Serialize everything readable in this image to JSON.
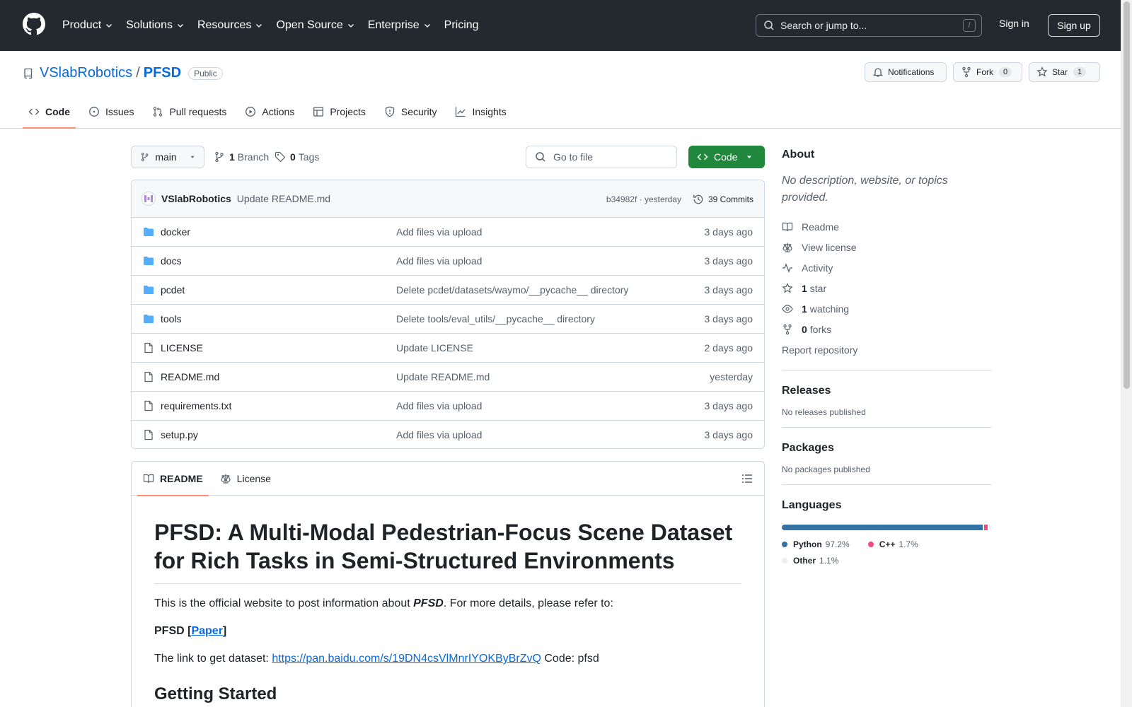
{
  "header": {
    "nav": [
      "Product",
      "Solutions",
      "Resources",
      "Open Source",
      "Enterprise",
      "Pricing"
    ],
    "search_placeholder": "Search or jump to...",
    "search_shortcut": "/",
    "sign_in": "Sign in",
    "sign_up": "Sign up"
  },
  "repo": {
    "owner": "VSlabRobotics",
    "separator": "/",
    "name": "PFSD",
    "visibility": "Public",
    "notifications_label": "Notifications",
    "fork_label": "Fork",
    "fork_count": "0",
    "star_label": "Star",
    "star_count": "1",
    "tabs": [
      "Code",
      "Issues",
      "Pull requests",
      "Actions",
      "Projects",
      "Security",
      "Insights"
    ]
  },
  "browser": {
    "branch": "main",
    "branch_count": "1",
    "branch_label": "Branch",
    "tag_count": "0",
    "tag_label": "Tags",
    "go_to_file": "Go to file",
    "code_button": "Code",
    "commit": {
      "author": "VSlabRobotics",
      "message": "Update README.md",
      "hash_time": "b34982f · yesterday",
      "commits_label": "39 Commits"
    },
    "files": [
      {
        "type": "folder",
        "name": "docker",
        "commit": "Add files via upload",
        "time": "3 days ago"
      },
      {
        "type": "folder",
        "name": "docs",
        "commit": "Add files via upload",
        "time": "3 days ago"
      },
      {
        "type": "folder",
        "name": "pcdet",
        "commit": "Delete pcdet/datasets/waymo/__pycache__ directory",
        "time": "3 days ago"
      },
      {
        "type": "folder",
        "name": "tools",
        "commit": "Delete tools/eval_utils/__pycache__ directory",
        "time": "3 days ago"
      },
      {
        "type": "file",
        "name": "LICENSE",
        "commit": "Update LICENSE",
        "time": "2 days ago"
      },
      {
        "type": "file",
        "name": "README.md",
        "commit": "Update README.md",
        "time": "yesterday"
      },
      {
        "type": "file",
        "name": "requirements.txt",
        "commit": "Add files via upload",
        "time": "3 days ago"
      },
      {
        "type": "file",
        "name": "setup.py",
        "commit": "Add files via upload",
        "time": "3 days ago"
      }
    ]
  },
  "readme": {
    "tabs": [
      "README",
      "License"
    ],
    "title": "PFSD: A Multi-Modal Pedestrian-Focus Scene Dataset for Rich Tasks in Semi-Structured Environments",
    "intro_prefix": "This is the official website to post information about ",
    "intro_em": "PFSD",
    "intro_suffix": ". For more details, please refer to:",
    "paper_prefix": "PFSD [",
    "paper_link": "Paper",
    "paper_suffix": "]",
    "dataset_prefix": "The link to get dataset: ",
    "dataset_link": "https://pan.baidu.com/s/19DN4csVlMnrIYOKByBrZvQ",
    "dataset_suffix": " Code: pfsd",
    "h2": "Getting Started"
  },
  "about": {
    "title": "About",
    "description": "No description, website, or topics provided.",
    "items": [
      "Readme",
      "View license",
      "Activity"
    ],
    "stars_count": "1",
    "stars_label": "star",
    "watching_count": "1",
    "watching_label": "watching",
    "forks_count": "0",
    "forks_label": "forks",
    "report": "Report repository"
  },
  "releases": {
    "title": "Releases",
    "note": "No releases published"
  },
  "packages": {
    "title": "Packages",
    "note": "No packages published"
  },
  "languages": {
    "title": "Languages",
    "list": [
      {
        "name": "Python",
        "pct": "97.2%",
        "value": 97.2,
        "color": "#3572A5"
      },
      {
        "name": "C++",
        "pct": "1.7%",
        "value": 1.7,
        "color": "#f34b7d"
      },
      {
        "name": "Other",
        "pct": "1.1%",
        "value": 1.1,
        "color": "#ededed"
      }
    ]
  }
}
